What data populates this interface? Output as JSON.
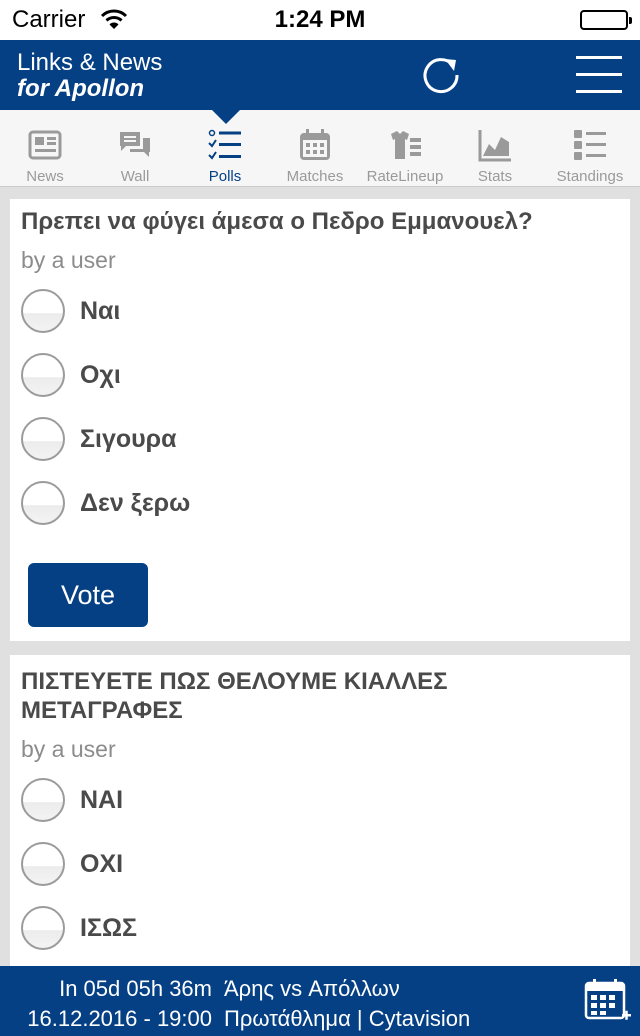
{
  "status_bar": {
    "carrier": "Carrier",
    "time": "1:24 PM"
  },
  "header": {
    "title_line1": "Links & News",
    "title_line2": "for Apollon"
  },
  "tabs": [
    {
      "label": "News",
      "icon": "newspaper-icon"
    },
    {
      "label": "Wall",
      "icon": "chat-bubbles-icon"
    },
    {
      "label": "Polls",
      "icon": "checklist-icon",
      "active": true
    },
    {
      "label": "Matches",
      "icon": "calendar-icon"
    },
    {
      "label": "RateLineup",
      "icon": "jersey-list-icon"
    },
    {
      "label": "Stats",
      "icon": "area-chart-icon"
    },
    {
      "label": "Standings",
      "icon": "numbered-list-icon"
    }
  ],
  "polls": [
    {
      "question": "Πρεπει να φύγει άμεσα ο Πεδρο Εμμανουελ?",
      "author": "by a user",
      "options": [
        "Ναι",
        "Οχι",
        "Σιγουρα",
        "Δεν ξερω"
      ],
      "vote_label": "Vote"
    },
    {
      "question_line1": "ΠΙΣΤΕΥΕΤΕ ΠΩΣ ΘΕΛΟΥΜΕ ΚΙΑΛΛΕΣ",
      "question_line2": "ΜΕΤΑΓΡΑΦΕΣ",
      "author": "by a user",
      "options": [
        "ΝΑΙ",
        "ΟΧΙ",
        "ΙΣΩΣ"
      ]
    }
  ],
  "footer": {
    "countdown": "In 05d 05h 36m",
    "match": "Άρης vs Απόλλων",
    "date": "16.12.2016 - 19:00",
    "info": "Πρωτάθλημα | Cytavision"
  },
  "colors": {
    "brand": "#054085",
    "background": "#e0e0e0",
    "inactive_tab": "#9a9a9a"
  }
}
